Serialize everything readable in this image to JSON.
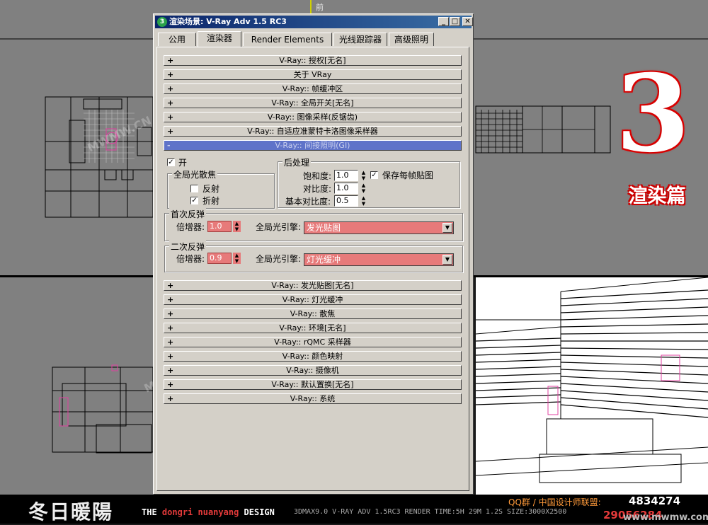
{
  "dialog": {
    "title": "渲染场景: V-Ray Adv 1.5 RC3",
    "title_icon": "3",
    "buttons": {
      "minimize": "_",
      "maximize": "□",
      "close": "✕"
    },
    "tabs": [
      "公用",
      "渲染器",
      "Render Elements",
      "光线跟踪器",
      "高级照明"
    ],
    "active_tab": "渲染器",
    "rollouts_top": [
      "V-Ray:: 授权[无名]",
      "关于 VRay",
      "V-Ray:: 帧缓冲区",
      "V-Ray:: 全局开关[无名]",
      "V-Ray:: 图像采样(反锯齿)",
      "V-Ray:: 自适应准蒙特卡洛图像采样器"
    ],
    "open_rollout": "V-Ray:: 间接照明(GI)",
    "gi": {
      "on_label": "开",
      "on_checked": "✓",
      "caustics_group": "全局光散焦",
      "reflect_label": "反射",
      "reflect_checked": "",
      "refract_label": "折射",
      "refract_checked": "✓",
      "post_group": "后处理",
      "saturation_label": "饱和度:",
      "saturation_value": "1.0",
      "contrast_label": "对比度:",
      "contrast_value": "1.0",
      "contrast_base_label": "基本对比度:",
      "contrast_base_value": "0.5",
      "save_maps_label": "保存每帧贴图",
      "save_maps_checked": "✓",
      "primary_group": "首次反弹",
      "primary_mult_label": "倍增器:",
      "primary_mult_value": "1.0",
      "primary_engine_label": "全局光引擎:",
      "primary_engine_value": "发光贴图",
      "secondary_group": "二次反弹",
      "secondary_mult_label": "倍增器:",
      "secondary_mult_value": "0.9",
      "secondary_engine_label": "全局光引擎:",
      "secondary_engine_value": "灯光缓冲"
    },
    "rollouts_bottom": [
      "V-Ray:: 发光贴图[无名]",
      "V-Ray:: 灯光缓冲",
      "V-Ray:: 散焦",
      "V-Ray:: 环境[无名]",
      "V-Ray:: rQMC 采样器",
      "V-Ray:: 颜色映射",
      "V-Ray:: 摄像机",
      "V-Ray:: 默认置换[无名]",
      "V-Ray:: 系统"
    ],
    "plus": "+",
    "minus": "-"
  },
  "viewport": {
    "front_label": "前"
  },
  "badge": {
    "number": "3",
    "text": "渲染篇"
  },
  "watermark": "MWMW.CN",
  "footer": {
    "logo": "冬日暖陽",
    "the": "THE",
    "brand_red": "dongri nuanyang",
    "design": "DESIGN",
    "info": "3DMAX9.0  V-RAY ADV 1.5RC3  RENDER TIME:5H 29M 1.2S  SIZE:3000X2500",
    "qq_label": "QQ群 / 中国设计师联盟:",
    "qq_number": "4834274",
    "qq_number2": "29056284",
    "url": "www.mwmw.com.cn"
  },
  "colors": {
    "accent_red": "#e77a7a",
    "rollout_open": "#5f73c9",
    "dialog_bg": "#d4d0c8"
  }
}
